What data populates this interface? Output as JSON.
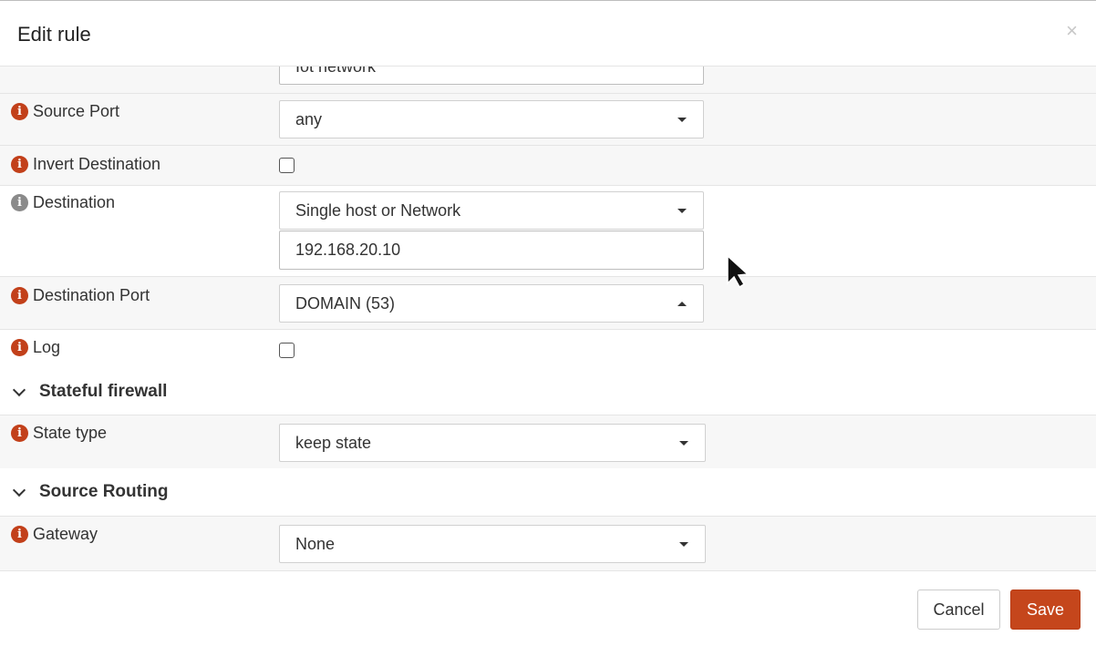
{
  "dialog": {
    "title": "Edit rule",
    "close_glyph": "×"
  },
  "fields": {
    "source_partial_value": "Iot network",
    "source_port": {
      "label": "Source Port",
      "value": "any"
    },
    "invert_destination": {
      "label": "Invert Destination",
      "checked": false
    },
    "destination": {
      "label": "Destination",
      "value": "Single host or Network",
      "address": "192.168.20.10"
    },
    "destination_port": {
      "label": "Destination Port",
      "value": "DOMAIN (53)"
    },
    "log": {
      "label": "Log",
      "checked": false
    },
    "state_type": {
      "label": "State type",
      "value": "keep state"
    },
    "gateway": {
      "label": "Gateway",
      "value": "None"
    }
  },
  "sections": {
    "stateful_firewall": "Stateful firewall",
    "source_routing": "Source Routing"
  },
  "footer": {
    "cancel_label": "Cancel",
    "save_label": "Save"
  },
  "icons": {
    "info": "info-icon",
    "dropdown": "caret-down-icon",
    "collapse": "chevron-down-icon"
  },
  "colors": {
    "accent": "#c5461c",
    "info_red": "#c2401a",
    "info_gray": "#8a8a8a"
  }
}
